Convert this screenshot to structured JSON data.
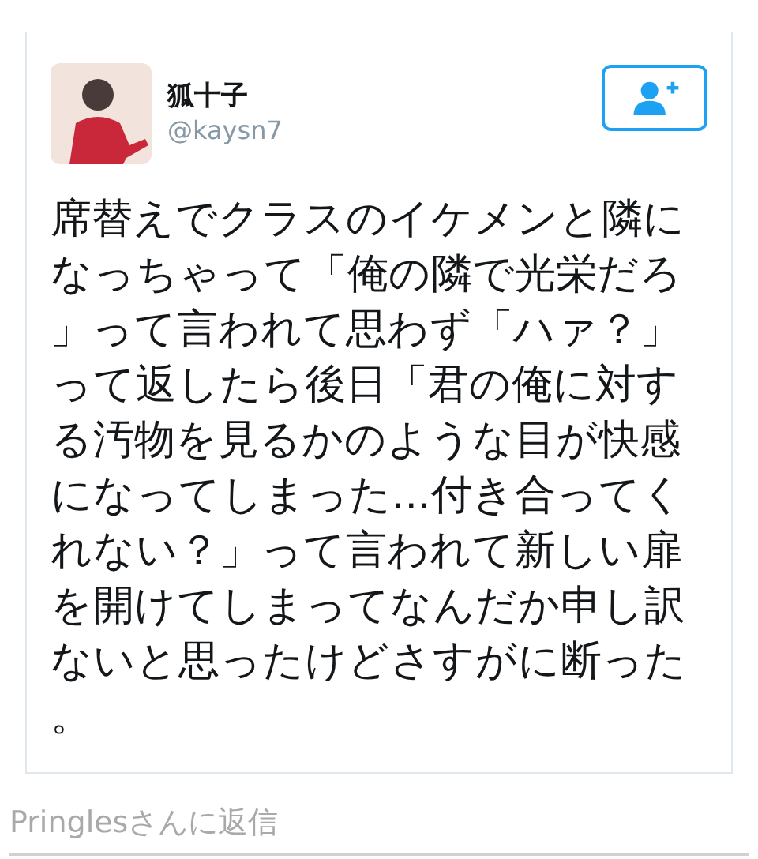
{
  "tweet": {
    "author_name": "狐十子",
    "handle": "@kaysn7",
    "text": "席替えでクラスのイケメンと隣になっちゃって「俺の隣で光栄だろ」って言われて思わず「ハァ？」って返したら後日「君の俺に対する汚物を見るかのような目が快感になってしまった...付き合ってくれない？」って言われて新しい扉を開けてしまってなんだか申し訳ないと思ったけどさすがに断った。"
  },
  "reply": {
    "placeholder": "Pringlesさんに返信"
  }
}
